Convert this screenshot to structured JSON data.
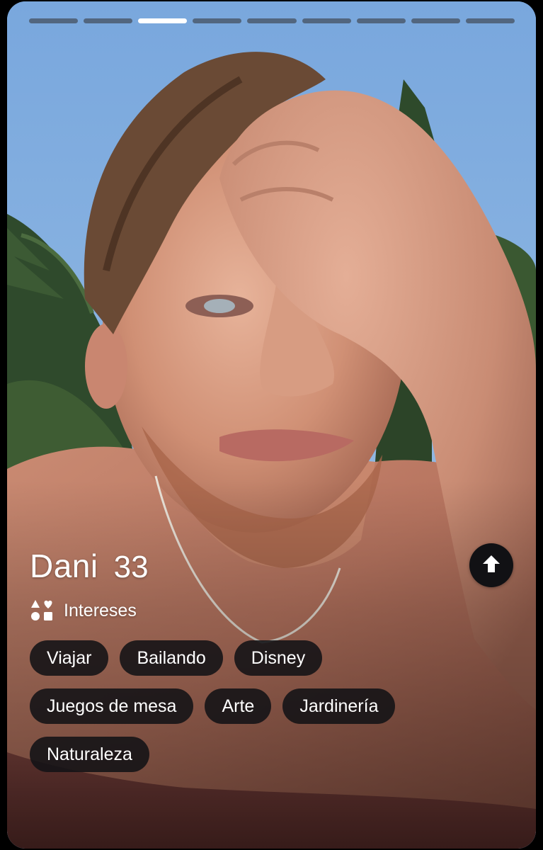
{
  "progress": {
    "total_photos": 9,
    "current_photo": 3
  },
  "profile": {
    "name": "Dani",
    "age": "33"
  },
  "interests": {
    "label": "Intereses",
    "icon": "shapes-icon",
    "chips": [
      "Viajar",
      "Bailando",
      "Disney",
      "Juegos de mesa",
      "Arte",
      "Jardinería",
      "Naturaleza"
    ]
  },
  "actions": {
    "expand_icon": "arrow-up-icon"
  },
  "colors": {
    "chip_background": "#121216",
    "progress_active": "#ffffff",
    "progress_inactive": "#46505f",
    "button_background": "#111114"
  }
}
